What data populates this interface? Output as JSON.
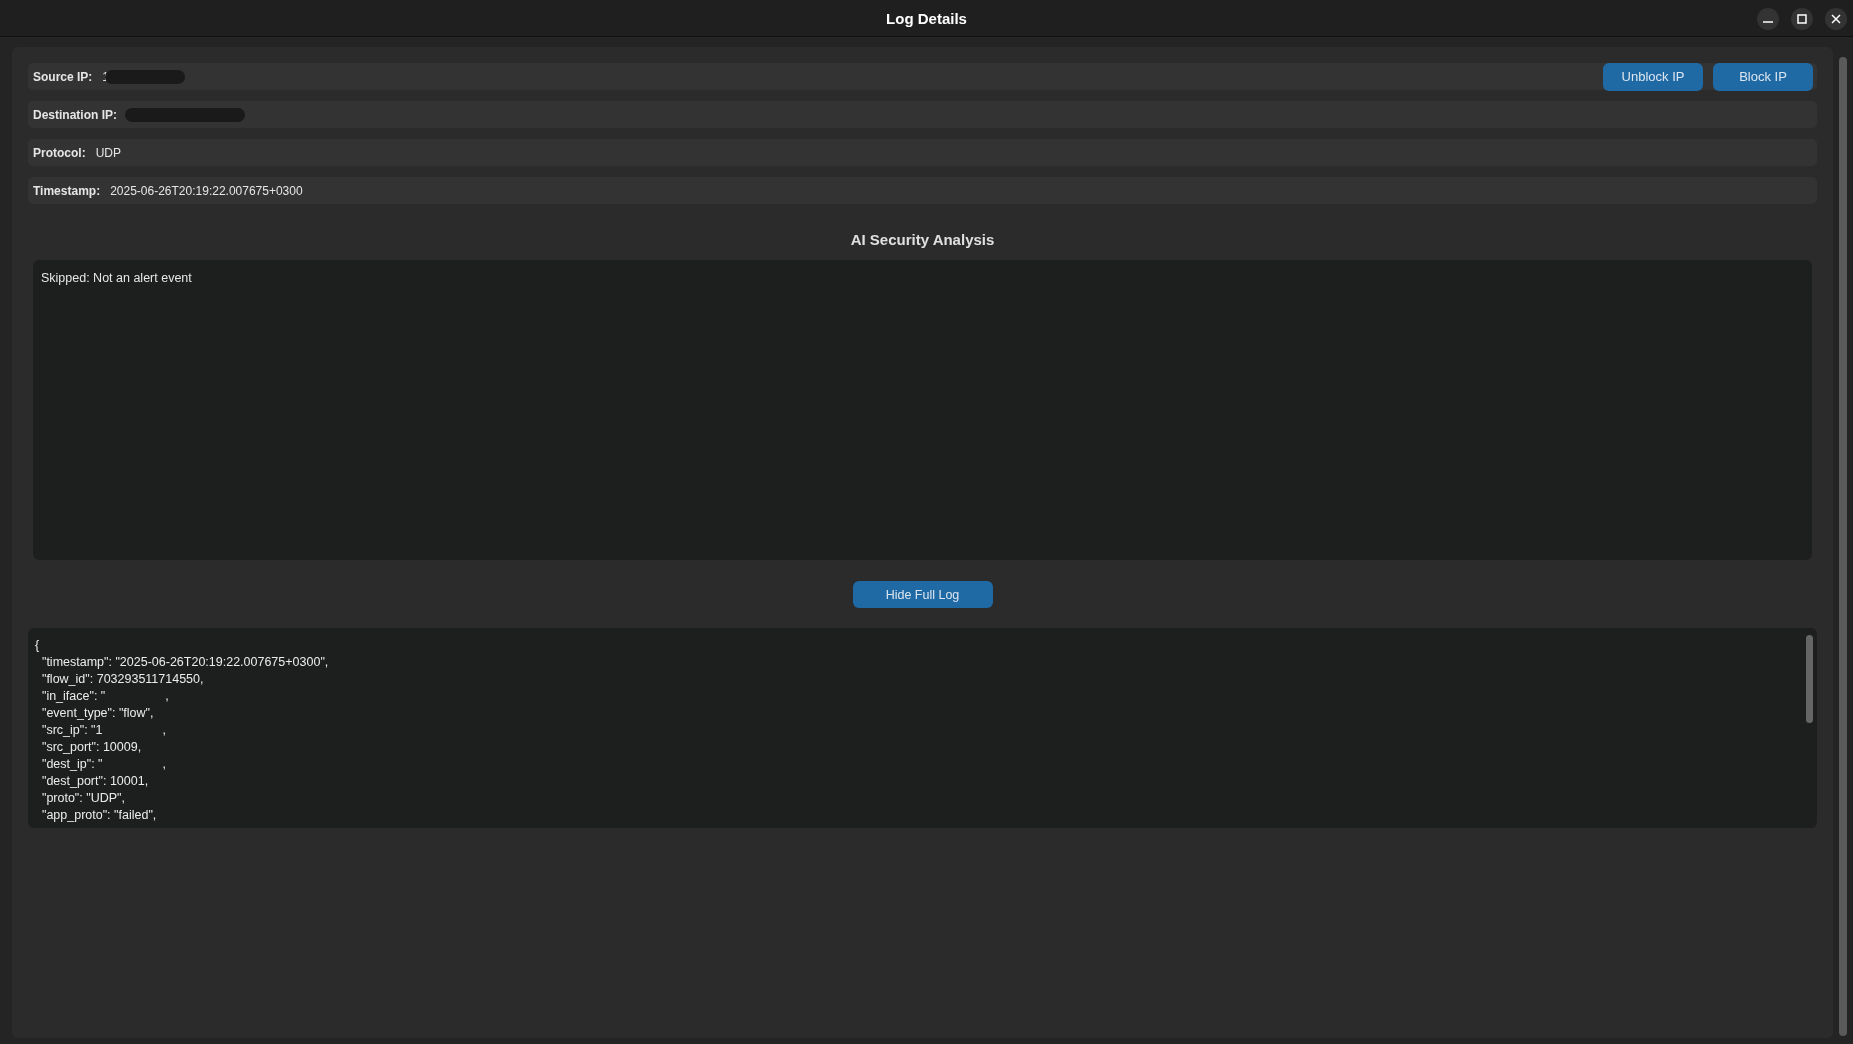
{
  "window": {
    "title": "Log Details"
  },
  "fields": [
    {
      "label": "Source IP:",
      "value": "1",
      "redacted": true
    },
    {
      "label": "Destination IP:",
      "redacted": true
    },
    {
      "label": "Protocol:",
      "value": "UDP",
      "redacted": false
    },
    {
      "label": "Timestamp:",
      "value": "2025-06-26T20:19:22.007675+0300",
      "redacted": false
    }
  ],
  "actions": [
    "Unblock IP",
    "Block IP"
  ],
  "analysis": {
    "title": "AI Security Analysis",
    "text": "Skipped: Not an alert event"
  },
  "toggle_button": "Hide Full Log",
  "log_lines": [
    {
      "text": "{"
    },
    {
      "text": "  \"timestamp\": \"2025-06-26T20:19:22.007675+0300\","
    },
    {
      "text": "  \"flow_id\": 703293511714550,"
    },
    {
      "text": "  \"in_iface\": \"",
      "after": ","
    },
    {
      "text": "  \"event_type\": \"flow\","
    },
    {
      "text": "  \"src_ip\": \"1",
      "after": ","
    },
    {
      "text": "  \"src_port\": 10009,"
    },
    {
      "text": "  \"dest_ip\": \"",
      "after": ","
    },
    {
      "text": "  \"dest_port\": 10001,"
    },
    {
      "text": "  \"proto\": \"UDP\","
    },
    {
      "text": "  \"app_proto\": \"failed\","
    }
  ]
}
